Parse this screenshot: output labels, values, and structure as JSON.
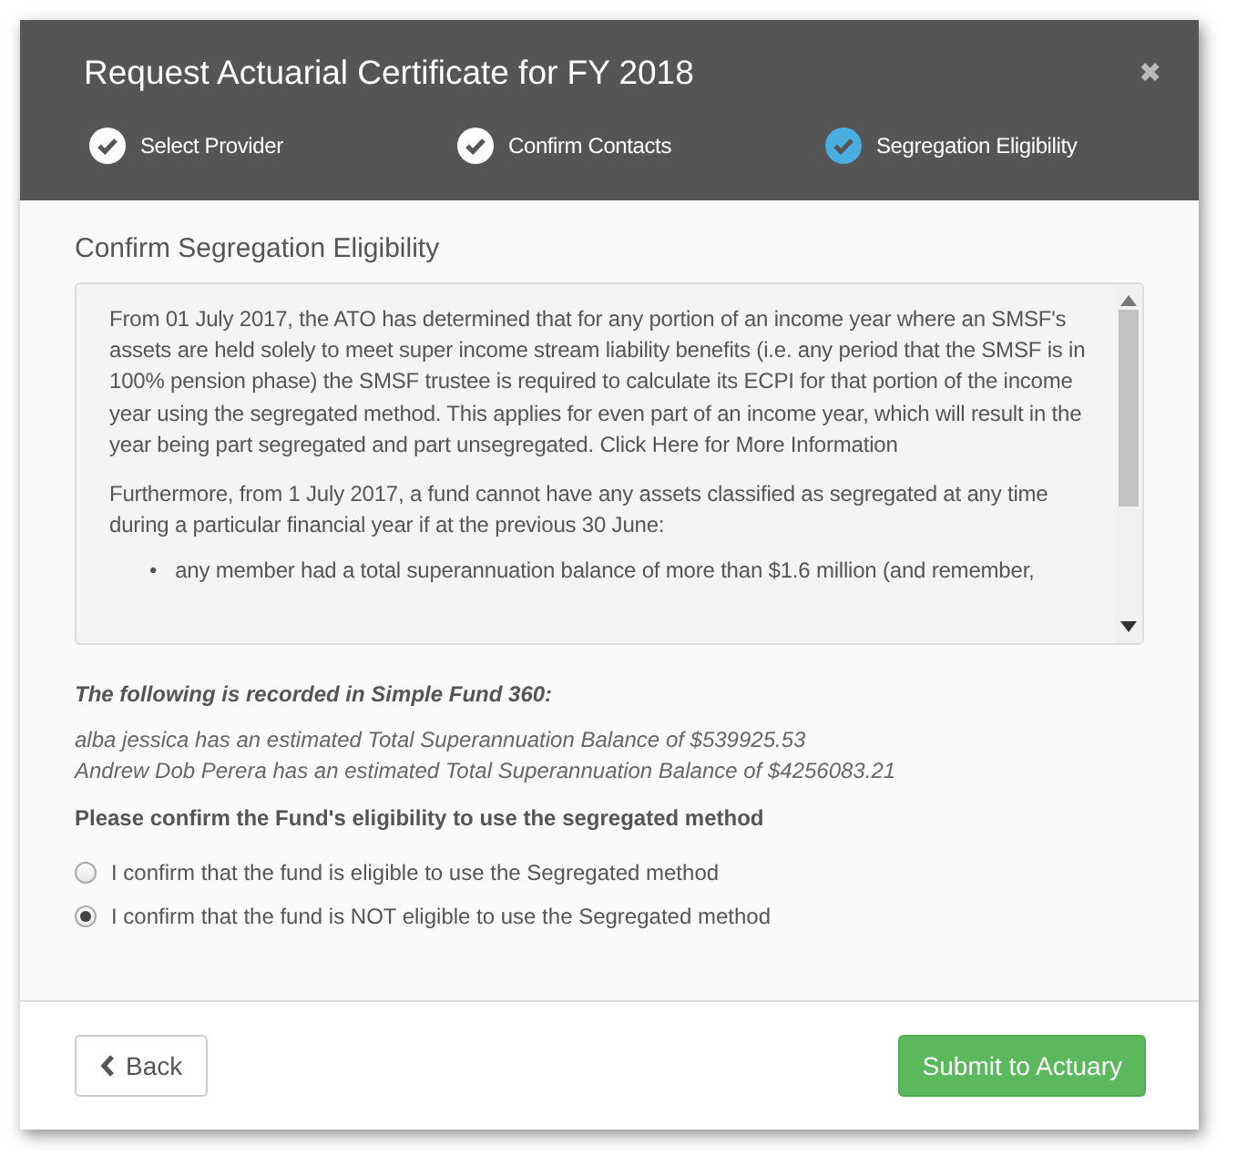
{
  "dialog": {
    "title": "Request Actuarial Certificate for FY 2018",
    "close": "✖"
  },
  "steps": [
    {
      "label": "Select Provider",
      "selected": false
    },
    {
      "label": "Confirm Contacts",
      "selected": false
    },
    {
      "label": "Segregation Eligibility",
      "selected": true
    }
  ],
  "section_title": "Confirm Segregation Eligibility",
  "info_box": {
    "paragraphs": [
      "From 01 July 2017, the ATO has determined that for any portion of an income year where an SMSF's assets are held solely to meet super income stream liability benefits (i.e. any period that the SMSF is in 100% pension phase) the SMSF trustee is required to calculate its ECPI for that portion of the income year using the segregated method. This applies for even part of an income year, which will result in the year being part segregated and part unsegregated. Click Here for More Information",
      "Furthermore, from 1 July 2017, a fund cannot have any assets classified as segregated at any time during a particular financial year if at the previous 30 June:"
    ],
    "bullets": [
      {
        "marker": "•",
        "text": "any member had a total superannuation balance of more than $1.6 million (and remember,"
      }
    ]
  },
  "recorded_heading": "The following is recorded in Simple Fund 360:",
  "balances": [
    "alba jessica has an estimated Total Superannuation Balance of $539925.53",
    "Andrew Dob Perera has an estimated Total Superannuation Balance of $4256083.21"
  ],
  "question": "Please confirm the Fund's eligibility to use the segregated method",
  "options": [
    {
      "label": "I confirm that the fund is eligible to use the Segregated method",
      "selected": false
    },
    {
      "label": "I confirm that the fund is NOT eligible to use the Segregated method",
      "selected": true
    }
  ],
  "buttons": {
    "back": "Back",
    "submit": "Submit to Actuary"
  }
}
